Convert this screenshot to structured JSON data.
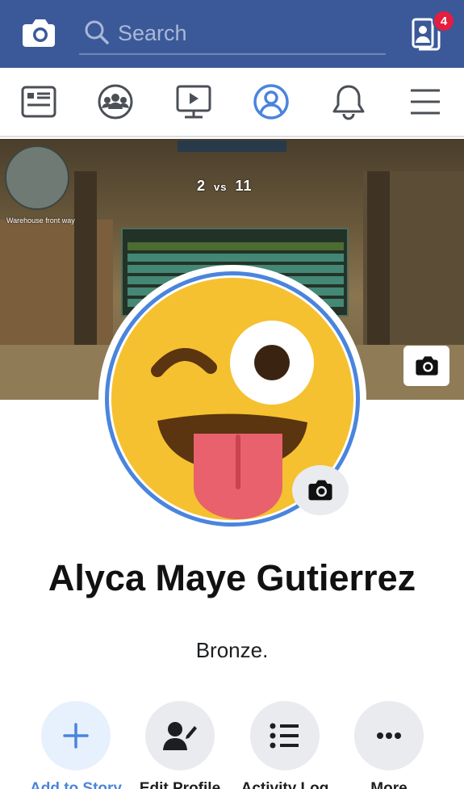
{
  "header": {
    "search_placeholder": "Search",
    "friend_requests_badge": "4"
  },
  "nav": {
    "items": [
      {
        "icon": "news-feed-icon"
      },
      {
        "icon": "groups-icon"
      },
      {
        "icon": "watch-icon"
      },
      {
        "icon": "profile-icon",
        "active": true
      },
      {
        "icon": "notifications-icon"
      },
      {
        "icon": "menu-icon"
      }
    ]
  },
  "cover": {
    "hud_score_left": "2",
    "hud_vs": "vs",
    "hud_score_right": "11",
    "location_text": "Warehouse front way"
  },
  "profile": {
    "name": "Alyca Maye Gutierrez",
    "bio": "Bronze."
  },
  "actions": [
    {
      "label": "Add to Story",
      "icon": "plus-icon"
    },
    {
      "label": "Edit Profile",
      "icon": "edit-profile-icon"
    },
    {
      "label": "Activity Log",
      "icon": "list-icon"
    },
    {
      "label": "More",
      "icon": "more-icon"
    }
  ],
  "colors": {
    "brand": "#3b5998",
    "accent": "#4a85dd",
    "badge": "#e41e3f"
  }
}
